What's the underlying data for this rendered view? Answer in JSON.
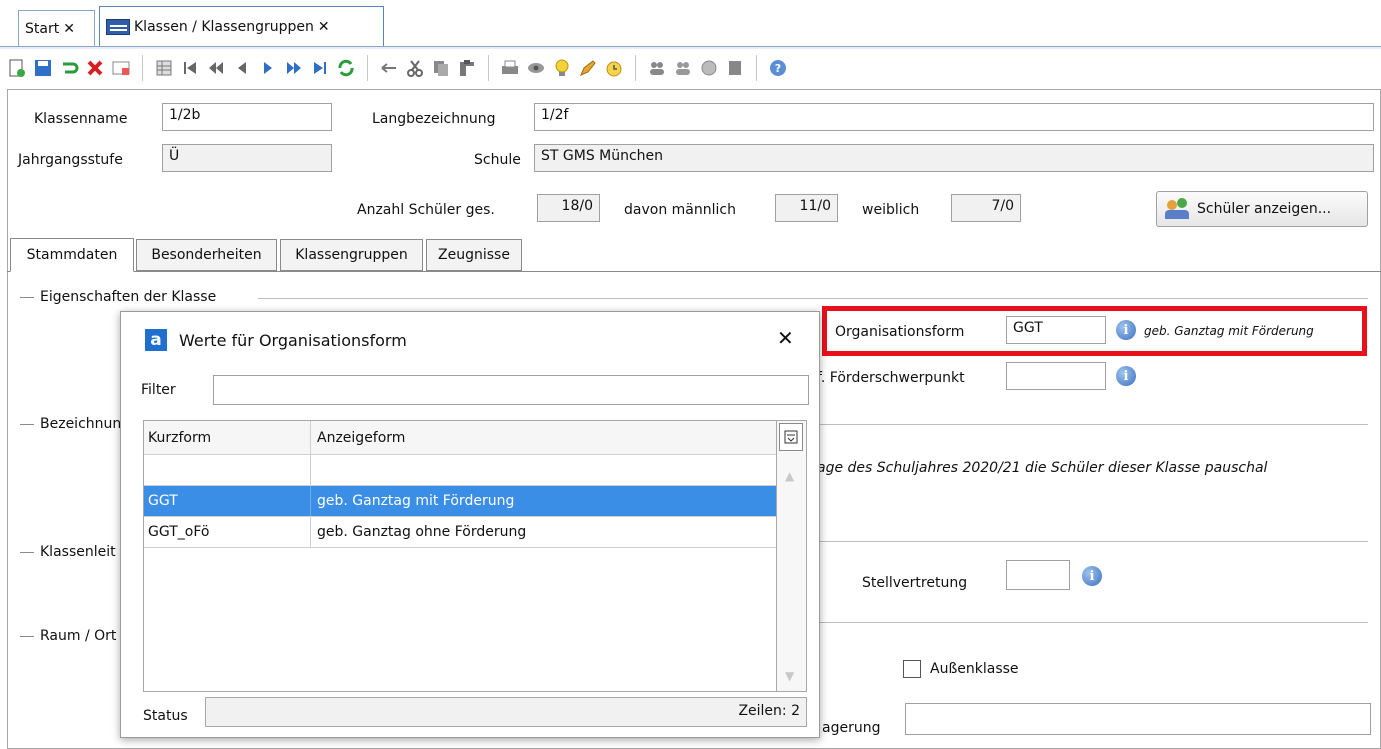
{
  "tabs": [
    {
      "label": "Start"
    },
    {
      "label": "Klassen / Klassengruppen"
    }
  ],
  "form": {
    "klassenname_label": "Klassenname",
    "klassenname_value": "1/2b",
    "langbezeichnung_label": "Langbezeichnung",
    "langbezeichnung_value": "1/2f",
    "jahrgangsstufe_label": "Jahrgangsstufe",
    "jahrgangsstufe_value": "Ü",
    "schule_label": "Schule",
    "schule_value": "ST GMS München",
    "anzahl_label": "Anzahl Schüler ges.",
    "anzahl_value": "18/0",
    "maennlich_label": "davon männlich",
    "maennlich_value": "11/0",
    "weiblich_label": "weiblich",
    "weiblich_value": "7/0",
    "schueler_button": "Schüler anzeigen..."
  },
  "inner_tabs": [
    "Stammdaten",
    "Besonderheiten",
    "Klassengruppen",
    "Zeugnisse"
  ],
  "groups": {
    "eigenschaften": "Eigenschaften der Klasse",
    "bezeichnung": "Bezeichnun",
    "klassenleitung": "Klassenleit",
    "raum": "Raum / Ort"
  },
  "right": {
    "organisationsform_label": "Organisationsform",
    "organisationsform_value": "GGT",
    "organisationsform_desc": "geb. Ganztag mit Förderung",
    "foerder_label": "f. Förderschwerpunkt",
    "info_text": "age des Schuljahres 2020/21 die Schüler dieser Klasse pauschal",
    "stellvertretung_label": "Stellvertretung",
    "aussenklasse_label": "Außenklasse",
    "agerung_label": "agerung"
  },
  "dialog": {
    "title": "Werte für Organisationsform",
    "filter_label": "Filter",
    "filter_value": "",
    "col_kurzform": "Kurzform",
    "col_anzeigeform": "Anzeigeform",
    "rows": [
      {
        "kurz": "",
        "anzeige": ""
      },
      {
        "kurz": "GGT",
        "anzeige": "geb. Ganztag mit Förderung"
      },
      {
        "kurz": "GGT_oFö",
        "anzeige": "geb. Ganztag ohne Förderung"
      }
    ],
    "status_label": "Status",
    "zeilen": "Zeilen: 2"
  },
  "colors": {
    "highlight_red": "#e8101a",
    "selection_blue": "#3a8ee6"
  }
}
